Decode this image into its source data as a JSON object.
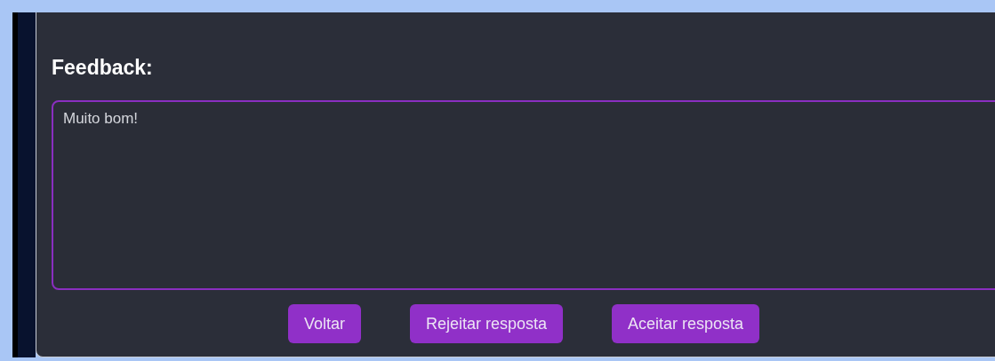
{
  "title": "Feedback:",
  "feedback_field": {
    "value": "Muito bom!"
  },
  "buttons": [
    {
      "label": "Voltar"
    },
    {
      "label": "Rejeitar resposta"
    },
    {
      "label": "Aceitar resposta"
    }
  ]
}
